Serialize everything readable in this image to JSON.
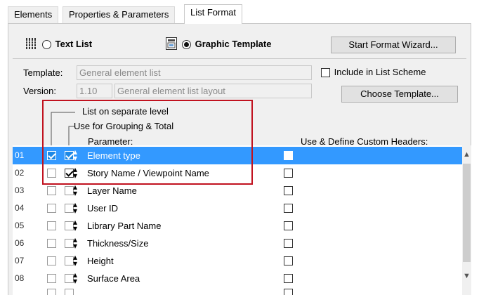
{
  "tabs": [
    {
      "label": "Elements"
    },
    {
      "label": "Properties & Parameters"
    },
    {
      "label": "List Format",
      "active": true
    }
  ],
  "format": {
    "text_list_label": "Text List",
    "graphic_template_label": "Graphic Template",
    "selected": "graphic_template",
    "wizard_button": "Start Format Wizard..."
  },
  "template": {
    "template_label": "Template:",
    "template_value": "General element list",
    "version_label": "Version:",
    "version_number": "1.10",
    "version_desc": "General element list layout",
    "include_label": "Include in List Scheme",
    "include_checked": false,
    "choose_button": "Choose Template..."
  },
  "headers": {
    "separate_level": "List on separate level",
    "grouping_total": "Use for Grouping & Total",
    "parameter": "Parameter:",
    "custom_headers": "Use & Define Custom Headers:"
  },
  "rows": [
    {
      "num": "01",
      "name": "Element type",
      "level": true,
      "group": true,
      "custom": false,
      "selected": true
    },
    {
      "num": "02",
      "name": "Story Name / Viewpoint Name",
      "level": false,
      "group": true,
      "custom": false,
      "selected": false
    },
    {
      "num": "03",
      "name": "Layer Name",
      "level": false,
      "group": false,
      "custom": false,
      "selected": false
    },
    {
      "num": "04",
      "name": "User ID",
      "level": false,
      "group": false,
      "custom": false,
      "selected": false
    },
    {
      "num": "05",
      "name": "Library Part Name",
      "level": false,
      "group": false,
      "custom": false,
      "selected": false
    },
    {
      "num": "06",
      "name": "Thickness/Size",
      "level": false,
      "group": false,
      "custom": false,
      "selected": false
    },
    {
      "num": "07",
      "name": "Height",
      "level": false,
      "group": false,
      "custom": false,
      "selected": false
    },
    {
      "num": "08",
      "name": "Surface Area",
      "level": false,
      "group": false,
      "custom": false,
      "selected": false
    }
  ],
  "colors": {
    "selection": "#3399ff",
    "highlight_box": "#c1121f"
  }
}
